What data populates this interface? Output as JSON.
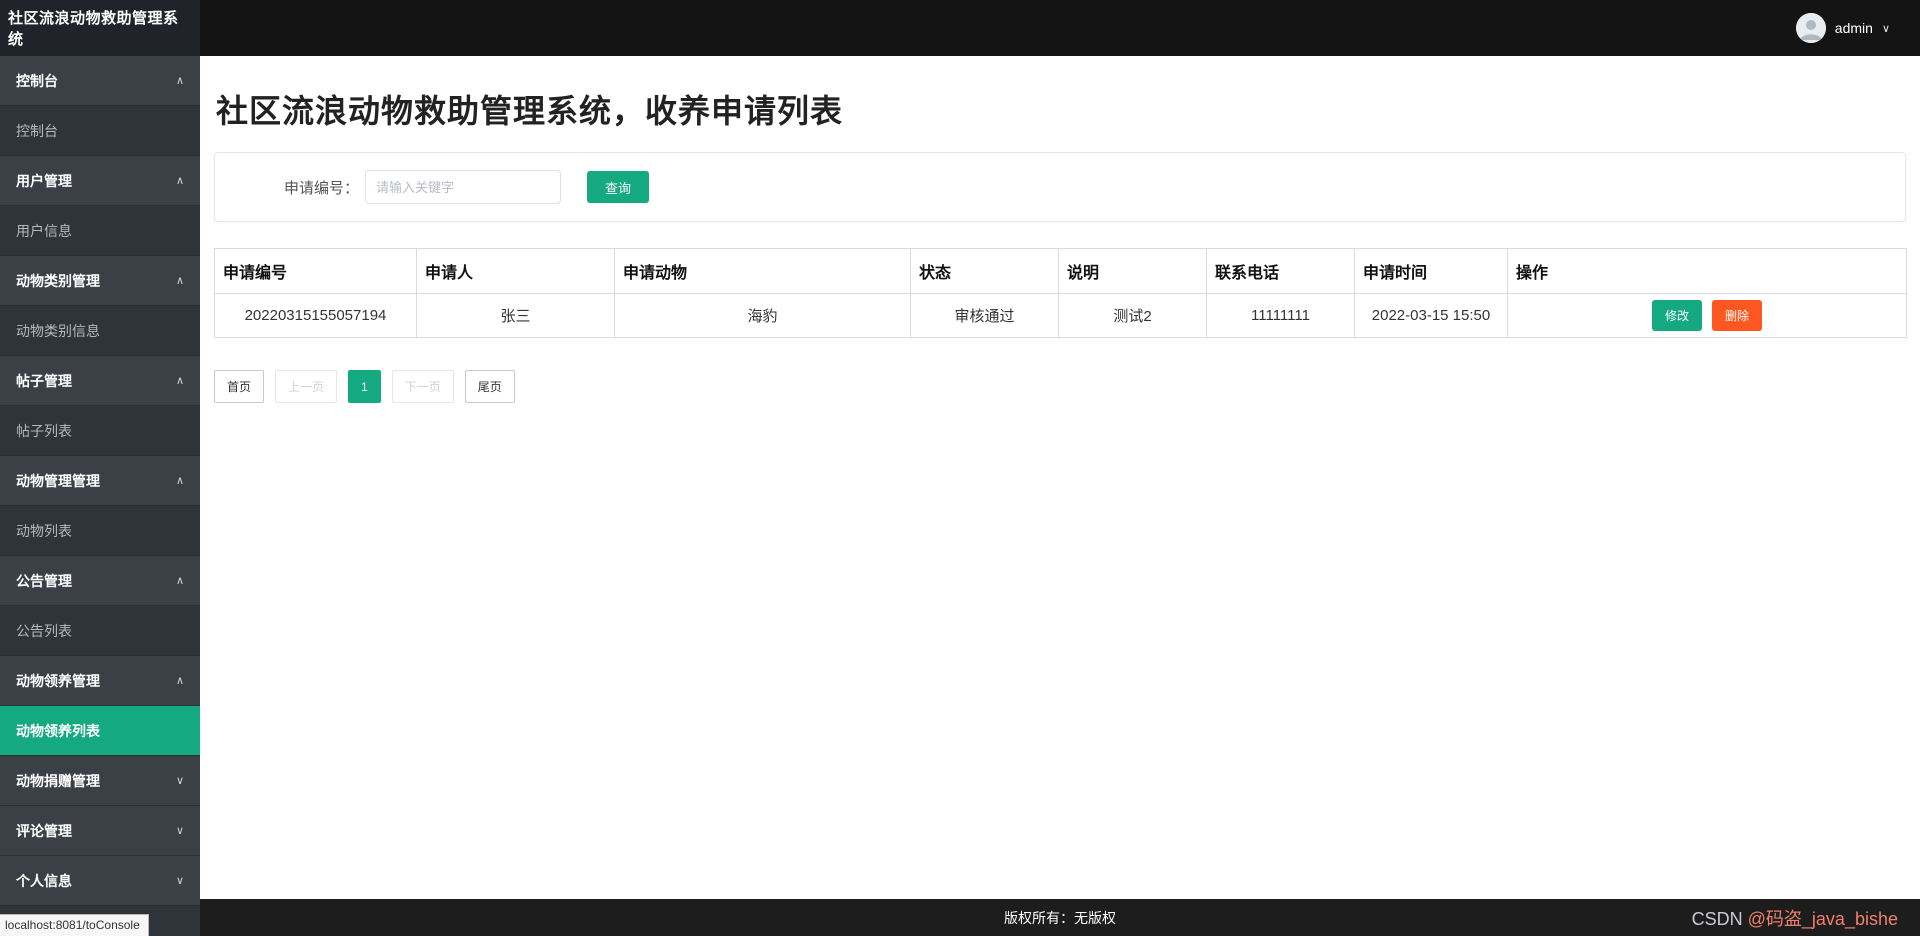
{
  "app": {
    "title": "社区流浪动物救助管理系统",
    "user": "admin"
  },
  "icons": {
    "chevron_up": "∧",
    "chevron_down": "∨"
  },
  "colors": {
    "accent": "#15a981",
    "danger": "#ff5722",
    "sidebar_bg": "#2f343a",
    "topbar_bg": "#141414"
  },
  "sidebar": {
    "groups": [
      {
        "label": "控制台",
        "expanded": true,
        "items": [
          {
            "label": "控制台",
            "active": false
          }
        ]
      },
      {
        "label": "用户管理",
        "expanded": true,
        "items": [
          {
            "label": "用户信息",
            "active": false
          }
        ]
      },
      {
        "label": "动物类别管理",
        "expanded": true,
        "items": [
          {
            "label": "动物类别信息",
            "active": false
          }
        ]
      },
      {
        "label": "帖子管理",
        "expanded": true,
        "items": [
          {
            "label": "帖子列表",
            "active": false
          }
        ]
      },
      {
        "label": "动物管理管理",
        "expanded": true,
        "items": [
          {
            "label": "动物列表",
            "active": false
          }
        ]
      },
      {
        "label": "公告管理",
        "expanded": true,
        "items": [
          {
            "label": "公告列表",
            "active": false
          }
        ]
      },
      {
        "label": "动物领养管理",
        "expanded": true,
        "items": [
          {
            "label": "动物领养列表",
            "active": true
          }
        ]
      },
      {
        "label": "动物捐赠管理",
        "expanded": false,
        "items": []
      },
      {
        "label": "评论管理",
        "expanded": false,
        "items": []
      },
      {
        "label": "个人信息",
        "expanded": false,
        "items": []
      }
    ]
  },
  "browser": {
    "status_link": "localhost:8081/toConsole"
  },
  "main": {
    "page_title": "社区流浪动物救助管理系统，收养申请列表",
    "search": {
      "label": "申请编号：",
      "placeholder": "请输入关键字",
      "button": "查询"
    },
    "table": {
      "headers": [
        "申请编号",
        "申请人",
        "申请动物",
        "状态",
        "说明",
        "联系电话",
        "申请时间",
        "操作"
      ],
      "rows": [
        [
          "20220315155057194",
          "张三",
          "海豹",
          "审核通过",
          "测试2",
          "11111111",
          "2022-03-15 15:50"
        ]
      ],
      "actions": {
        "edit": "修改",
        "delete": "删除"
      }
    },
    "pagination": {
      "buttons": [
        {
          "label": "首页",
          "state": "normal"
        },
        {
          "label": "上一页",
          "state": "disabled"
        },
        {
          "label": "1",
          "state": "active"
        },
        {
          "label": "下一页",
          "state": "disabled"
        },
        {
          "label": "尾页",
          "state": "normal"
        }
      ],
      "current": "1"
    }
  },
  "footer": {
    "copyright": "版权所有：无版权",
    "watermark_prefix": "CSDN ",
    "watermark_handle": "@码盗_java_bishe"
  }
}
